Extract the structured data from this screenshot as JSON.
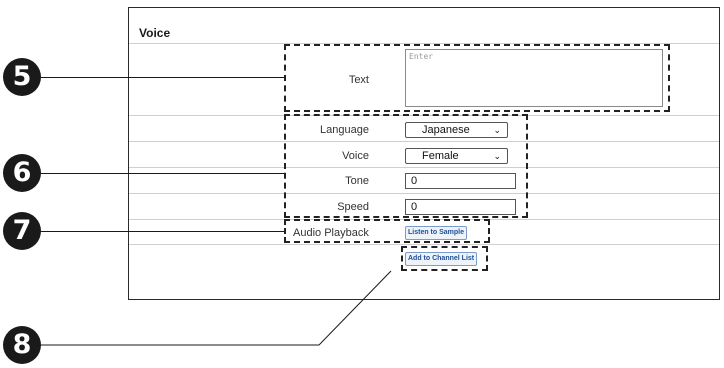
{
  "section": {
    "title": "Voice"
  },
  "fields": {
    "text": {
      "label": "Text",
      "placeholder": "Enter"
    },
    "language": {
      "label": "Language",
      "value": "Japanese"
    },
    "voice": {
      "label": "Voice",
      "value": "Female"
    },
    "tone": {
      "label": "Tone",
      "value": "0"
    },
    "speed": {
      "label": "Speed",
      "value": "0"
    },
    "audio_playback": {
      "label": "Audio Playback"
    }
  },
  "buttons": {
    "listen": "Listen to Sample",
    "add_channel": "Add to Channel List"
  },
  "callouts": [
    "5",
    "6",
    "7",
    "8"
  ]
}
